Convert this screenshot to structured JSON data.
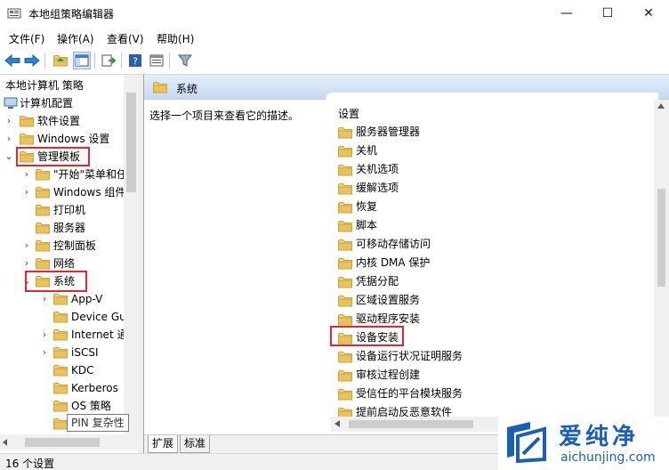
{
  "window": {
    "title": "本地组策略编辑器",
    "minimize": "—",
    "maximize": "☐",
    "close": "✕"
  },
  "menu": [
    "文件(F)",
    "操作(A)",
    "查看(V)",
    "帮助(H)"
  ],
  "toolbar": {
    "icons": [
      "back-arrow-icon",
      "forward-arrow-icon",
      "up-folder-icon",
      "show-hide-tree-icon",
      "export-list-icon",
      "help-icon",
      "properties-icon",
      "filter-icon"
    ]
  },
  "tree": {
    "root": "本地计算机 策略",
    "computer_config": "计算机配置",
    "software_settings": "软件设置",
    "windows_settings": "Windows 设置",
    "admin_templates": "管理模板",
    "start_menu": "\"开始\"菜单和任",
    "windows_components": "Windows 组件",
    "printers": "打印机",
    "server": "服务器",
    "control_panel": "控制面板",
    "network": "网络",
    "system": "系统",
    "app_v": "App-V",
    "device_guard": "Device Gu",
    "internet": "Internet 通",
    "iscsi": "iSCSI",
    "kdc": "KDC",
    "kerberos": "Kerberos",
    "os_policy": "OS 策略",
    "pin": "PIN 复杂性"
  },
  "right": {
    "header": "系统",
    "description": "选择一个项目来查看它的描述。",
    "column_header": "设置",
    "items": [
      "服务器管理器",
      "关机",
      "关机选项",
      "缓解选项",
      "恢复",
      "脚本",
      "可移动存储访问",
      "内核 DMA 保护",
      "凭据分配",
      "区域设置服务",
      "驱动程序安装",
      "设备安装",
      "设备运行状况证明服务",
      "审核过程创建",
      "受信任的平台模块服务",
      "提前启动反恶意软件"
    ]
  },
  "tabs": {
    "extended": "扩展",
    "standard": "标准"
  },
  "status": "16 个设置",
  "tooltip": "PIN 复杂性",
  "watermark": {
    "cn": "爱纯净",
    "en": "aichunjing.com"
  },
  "colors": {
    "folder": "#e8c25c",
    "highlight_box": "#e3262f",
    "header_gradient_top": "#e3eefb",
    "watermark": "#1a5fb4"
  }
}
